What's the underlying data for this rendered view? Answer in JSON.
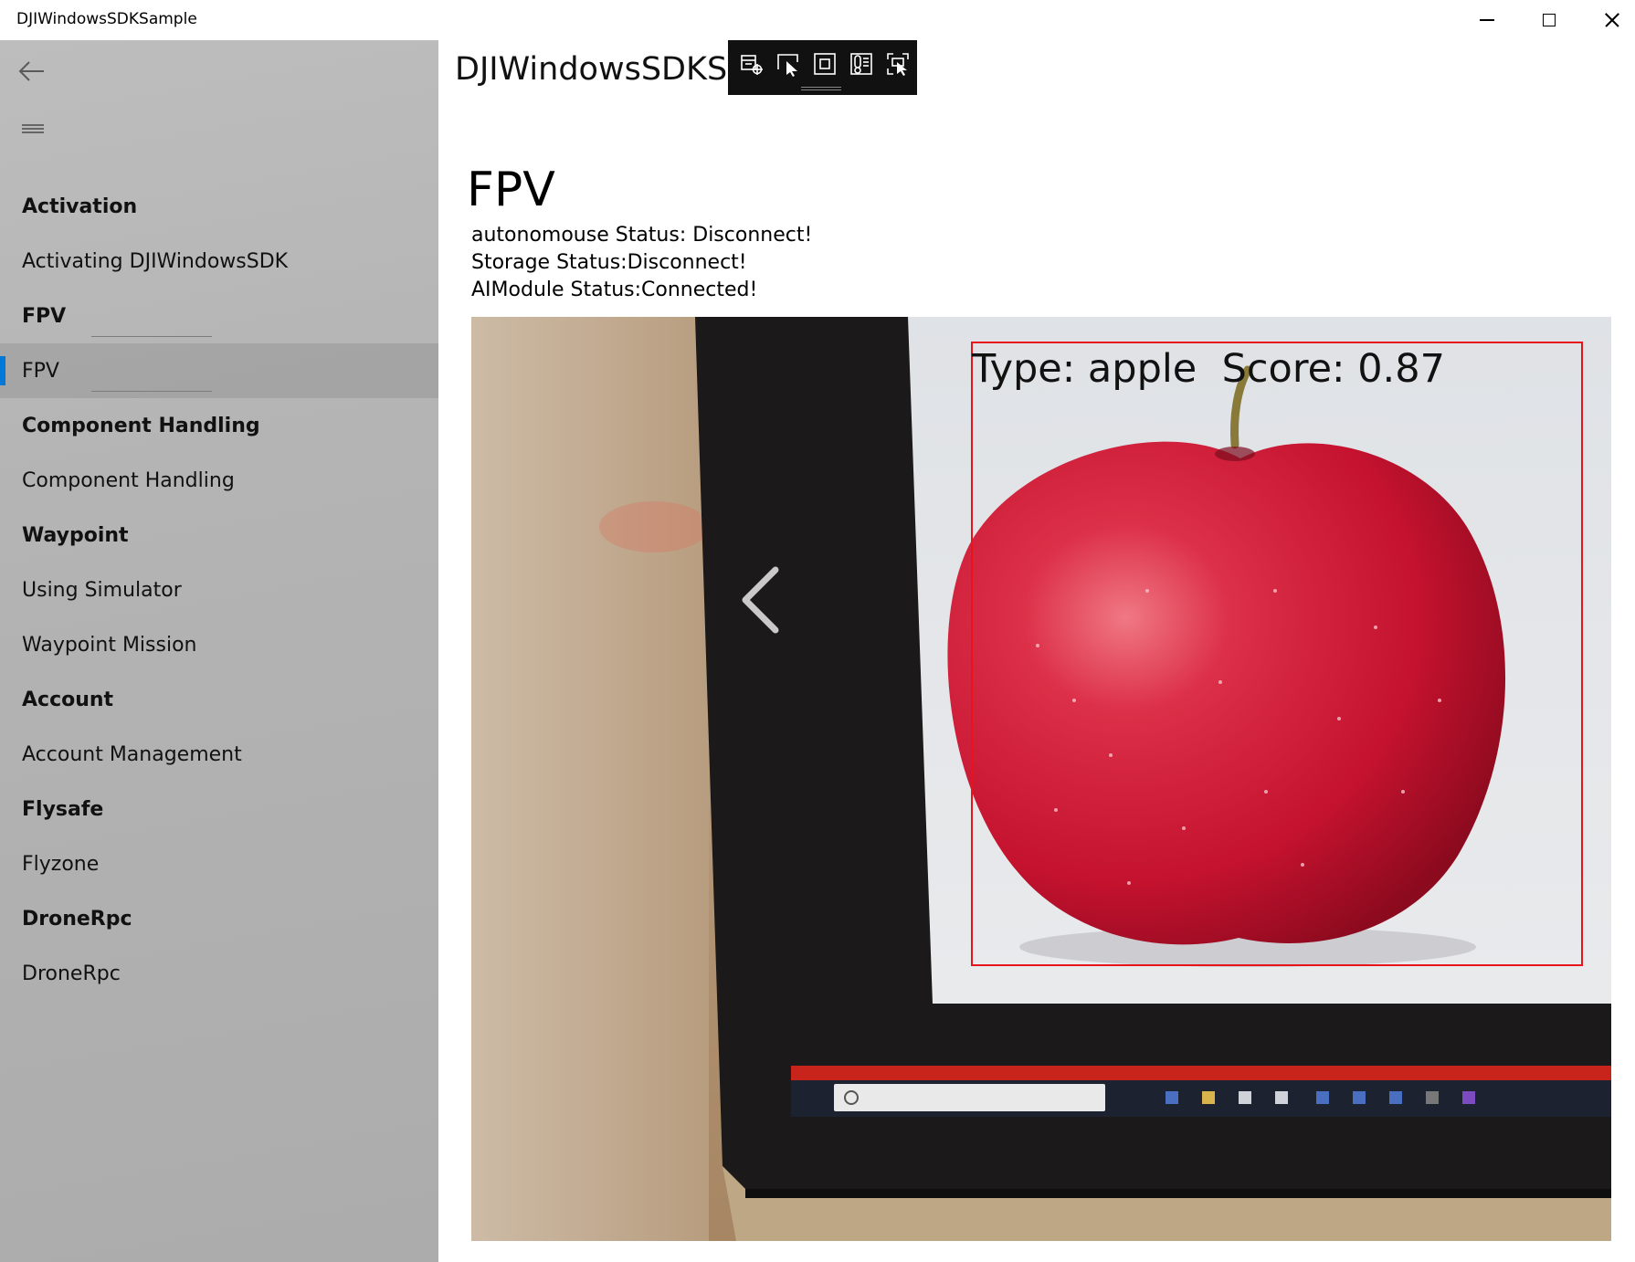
{
  "window": {
    "title": "DJIWindowsSDKSample",
    "controls": [
      "minimize",
      "maximize",
      "close"
    ]
  },
  "page_header": "DJIWindowsSDKSample",
  "nav": {
    "back_icon": "back-arrow-icon",
    "menu_icon": "hamburger-menu-icon",
    "items": [
      {
        "label": "Activation",
        "type": "header"
      },
      {
        "label": "Activating DJIWindowsSDK",
        "type": "item"
      },
      {
        "label": "FPV",
        "type": "header"
      },
      {
        "label": "FPV",
        "type": "item",
        "selected": true
      },
      {
        "label": "Component Handling",
        "type": "header"
      },
      {
        "label": "Component Handling",
        "type": "item"
      },
      {
        "label": "Waypoint",
        "type": "header"
      },
      {
        "label": "Using Simulator",
        "type": "item"
      },
      {
        "label": "Waypoint Mission",
        "type": "item"
      },
      {
        "label": "Account",
        "type": "header"
      },
      {
        "label": "Account Management",
        "type": "item"
      },
      {
        "label": "Flysafe",
        "type": "header"
      },
      {
        "label": "Flyzone",
        "type": "item"
      },
      {
        "label": "DroneRpc",
        "type": "header"
      },
      {
        "label": "DroneRpc",
        "type": "item"
      }
    ],
    "accent_color": "#0078d7"
  },
  "debug_toolbar": {
    "icons": [
      "live-visual-tree-icon",
      "select-element-icon",
      "display-layout-adorners-icon",
      "track-focus-icon",
      "preview-selection-icon"
    ]
  },
  "main": {
    "title": "FPV",
    "status_lines": [
      "autonomouse Status: Disconnect!",
      "Storage Status:Disconnect!",
      "AIModule Status:Connected!"
    ]
  },
  "detection": {
    "label": "Type: apple  Score: 0.87",
    "type": "apple",
    "score": 0.87,
    "box_color": "#e8141c"
  }
}
